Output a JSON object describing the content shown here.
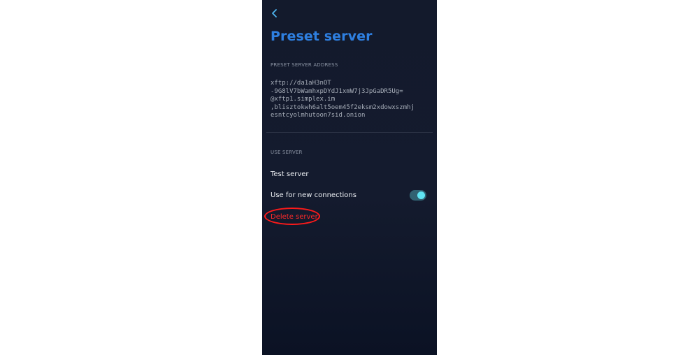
{
  "screen": {
    "title": "Preset server",
    "back_icon": "chevron-left-icon",
    "accent_color": "#2e7fe0",
    "toggle_color": "#5fe4f3",
    "danger_color": "#ff2a2a"
  },
  "address_section": {
    "label": "PRESET SERVER ADDRESS",
    "lines": [
      "xftp://da1aH3nOT",
      "-9G8lV7bWamhxpDYdJ1xmW7j3JpGaDR5Ug=",
      "@xftp1.simplex.im",
      ",blisztokwh6alt5oem45f2eksm2xdowxszmhj",
      "esntcyolmhutoon7sid.onion"
    ]
  },
  "use_section": {
    "label": "USE SERVER",
    "test_label": "Test server",
    "use_new_label": "Use for new connections",
    "use_new_enabled": true,
    "delete_label": "Delete server"
  }
}
